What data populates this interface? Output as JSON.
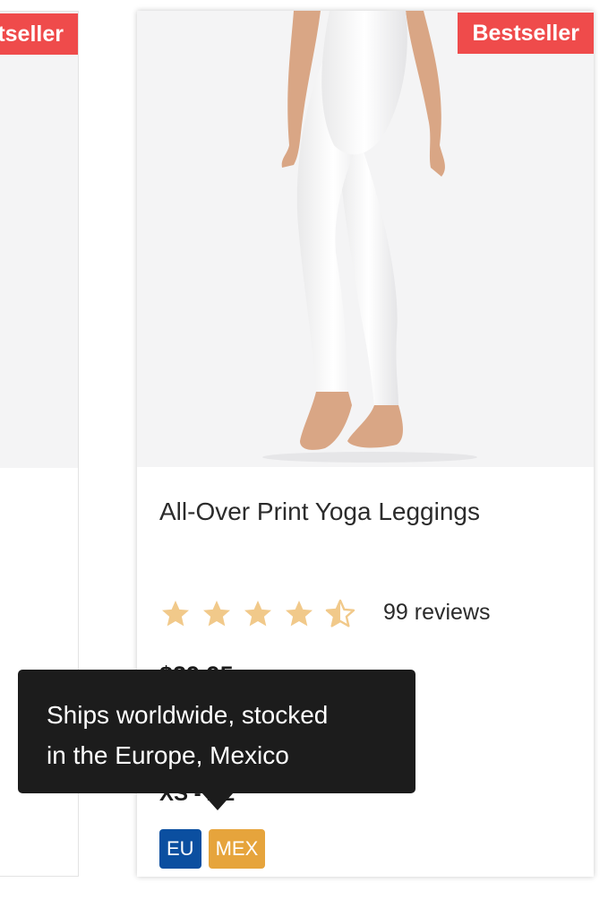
{
  "cards": {
    "left": {
      "badge": "tseller"
    },
    "main": {
      "badge": "Bestseller",
      "image_alt": "White all-over print yoga leggings",
      "title": "All-Over Print Yoga Leggings",
      "rating": 4.5,
      "reviews": "99 reviews",
      "price": "$29.95",
      "sizes": "XS - XL",
      "tags": [
        "EU",
        "MEX"
      ]
    }
  },
  "tooltip": {
    "line1": "Ships worldwide, stocked",
    "line2": "in the Europe, Mexico"
  },
  "colors": {
    "badge": "#ef4b4b",
    "star": "#f1c98a",
    "eu": "#0b4fa0",
    "mex": "#e6a43c",
    "tooltip": "#1c1c1c"
  }
}
